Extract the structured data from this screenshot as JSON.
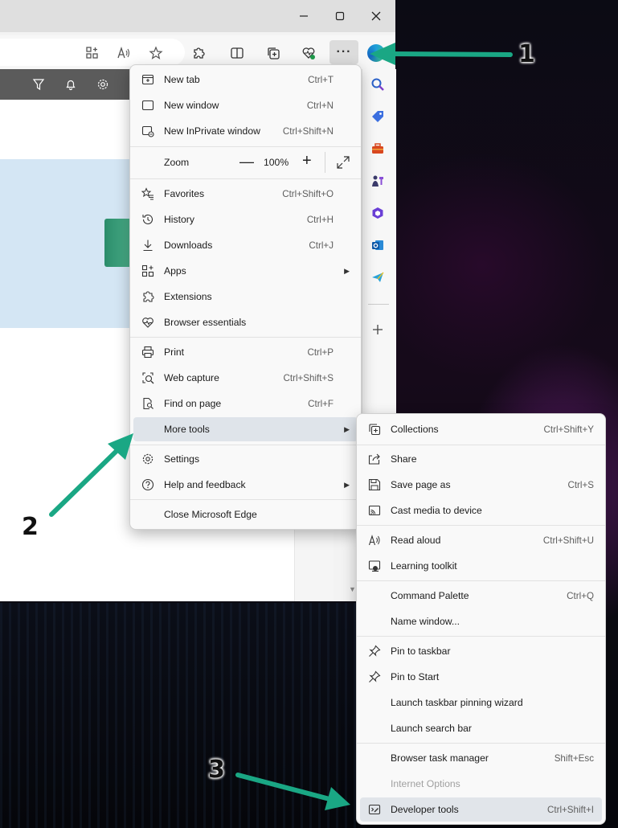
{
  "colors": {
    "menu_highlight": "#dfe4ea",
    "arrow": "#1aa784",
    "page_bar": "#5b5b5b"
  },
  "window": {
    "controls": [
      "minimize-icon",
      "maximize-icon",
      "close-icon"
    ]
  },
  "toolbar": {
    "icons": [
      "apps-icon",
      "read-aloud-icon",
      "favorite-star-icon",
      "extensions-icon",
      "split-screen-icon",
      "collections-icon",
      "browser-essentials-icon"
    ],
    "more_label": "···"
  },
  "sidebar": {
    "icons": [
      "search-icon",
      "shopping-tag-icon",
      "tools-icon",
      "games-icon",
      "office-icon",
      "outlook-icon",
      "send-icon",
      "add-icon"
    ]
  },
  "main_menu": {
    "items": [
      {
        "label": "New tab",
        "shortcut": "Ctrl+T"
      },
      {
        "label": "New window",
        "shortcut": "Ctrl+N"
      },
      {
        "label": "New InPrivate window",
        "shortcut": "Ctrl+Shift+N"
      },
      {
        "label": "Favorites",
        "shortcut": "Ctrl+Shift+O"
      },
      {
        "label": "History",
        "shortcut": "Ctrl+H"
      },
      {
        "label": "Downloads",
        "shortcut": "Ctrl+J"
      },
      {
        "label": "Apps",
        "shortcut": ""
      },
      {
        "label": "Extensions",
        "shortcut": ""
      },
      {
        "label": "Browser essentials",
        "shortcut": ""
      },
      {
        "label": "Print",
        "shortcut": "Ctrl+P"
      },
      {
        "label": "Web capture",
        "shortcut": "Ctrl+Shift+S"
      },
      {
        "label": "Find on page",
        "shortcut": "Ctrl+F"
      },
      {
        "label": "More tools",
        "shortcut": ""
      },
      {
        "label": "Settings",
        "shortcut": ""
      },
      {
        "label": "Help and feedback",
        "shortcut": ""
      },
      {
        "label": "Close Microsoft Edge",
        "shortcut": ""
      }
    ],
    "zoom": {
      "label": "Zoom",
      "minus": "—",
      "value": "100%",
      "plus": "+"
    }
  },
  "more_tools_menu": {
    "items": [
      {
        "label": "Collections",
        "shortcut": "Ctrl+Shift+Y"
      },
      {
        "label": "Share",
        "shortcut": ""
      },
      {
        "label": "Save page as",
        "shortcut": "Ctrl+S"
      },
      {
        "label": "Cast media to device",
        "shortcut": ""
      },
      {
        "label": "Read aloud",
        "shortcut": "Ctrl+Shift+U"
      },
      {
        "label": "Learning toolkit",
        "shortcut": ""
      },
      {
        "label": "Command Palette",
        "shortcut": "Ctrl+Q"
      },
      {
        "label": "Name window...",
        "shortcut": ""
      },
      {
        "label": "Pin to taskbar",
        "shortcut": ""
      },
      {
        "label": "Pin to Start",
        "shortcut": ""
      },
      {
        "label": "Launch taskbar pinning wizard",
        "shortcut": ""
      },
      {
        "label": "Launch search bar",
        "shortcut": ""
      },
      {
        "label": "Browser task manager",
        "shortcut": "Shift+Esc"
      },
      {
        "label": "Internet Options",
        "shortcut": ""
      },
      {
        "label": "Developer tools",
        "shortcut": "Ctrl+Shift+I"
      }
    ]
  },
  "annotations": {
    "step1": "1",
    "step2": "2",
    "step3": "3"
  }
}
